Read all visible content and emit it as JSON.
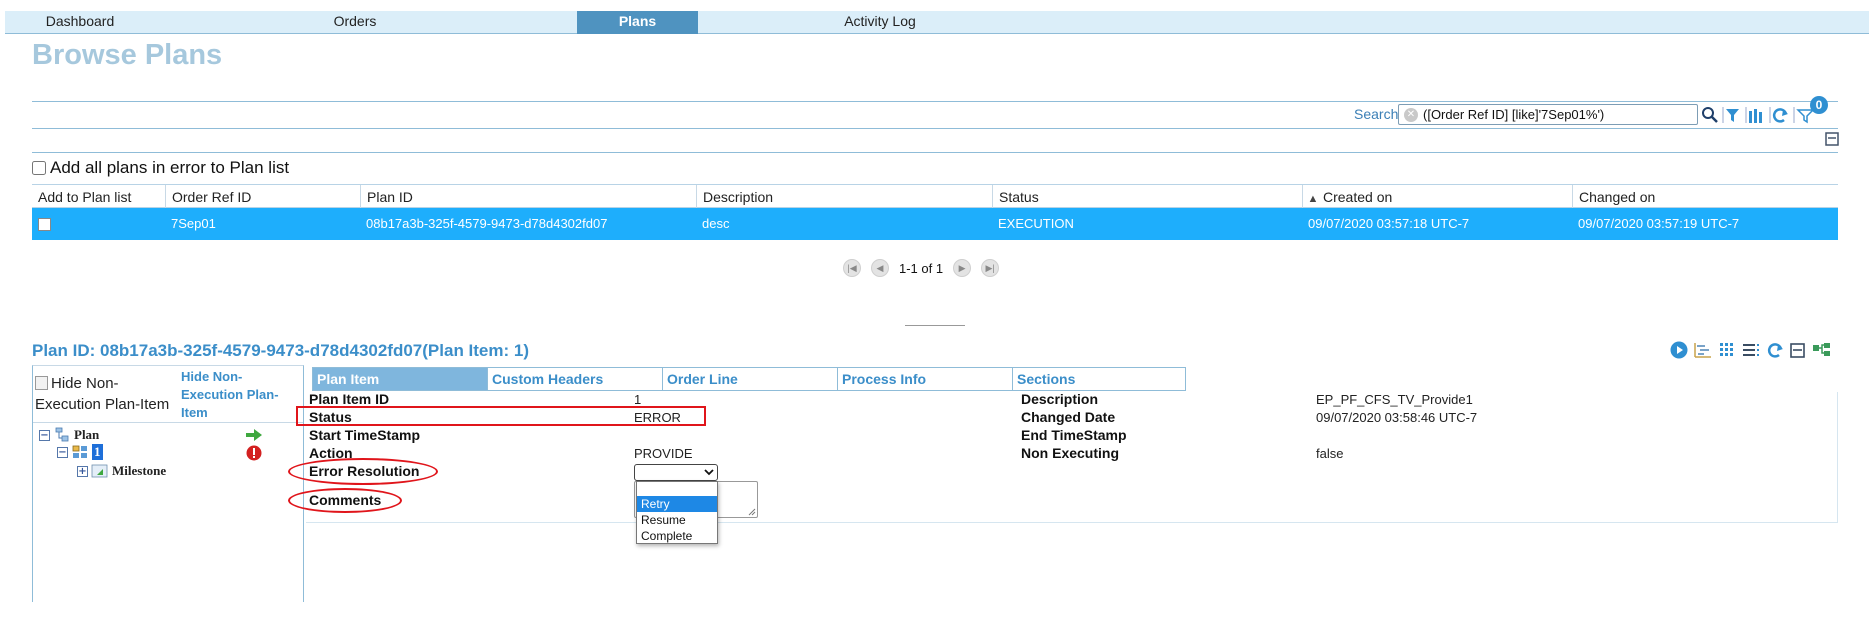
{
  "nav": {
    "tabs": [
      {
        "label": "Dashboard"
      },
      {
        "label": "Orders"
      },
      {
        "label": "Plans"
      },
      {
        "label": "Activity Log"
      }
    ]
  },
  "page": {
    "title": "Browse Plans"
  },
  "search": {
    "label": "Search",
    "value": "([Order Ref ID] [like]'7Sep01%')",
    "filter_count": "0"
  },
  "options": {
    "add_all_label": "Add all plans in error to Plan list"
  },
  "grid": {
    "columns": [
      "Add to Plan list",
      "Order Ref ID",
      "Plan ID",
      "Description",
      "Status",
      "Created on",
      "Changed on"
    ],
    "rows": [
      {
        "order_ref_id": "7Sep01",
        "plan_id": "08b17a3b-325f-4579-9473-d78d4302fd07",
        "description": "desc",
        "status": "EXECUTION",
        "created_on": "09/07/2020 03:57:18 UTC-7",
        "changed_on": "09/07/2020 03:57:19 UTC-7"
      }
    ],
    "pager": "1-1 of 1"
  },
  "detail": {
    "title": "Plan ID: 08b17a3b-325f-4579-9473-d78d4302fd07(Plan Item: 1)",
    "tree": {
      "image_alt": "Hide Non-Execution Plan-Item",
      "hide_link": "Hide Non-Execution Plan-Item",
      "nodes": [
        {
          "label": "Plan"
        },
        {
          "label": "1"
        },
        {
          "label": "Milestone"
        }
      ]
    },
    "tabs": [
      {
        "label": "Plan Item"
      },
      {
        "label": "Custom Headers"
      },
      {
        "label": "Order Line"
      },
      {
        "label": "Process Info"
      },
      {
        "label": "Sections"
      }
    ],
    "fields": {
      "plan_item_id": {
        "label": "Plan Item ID",
        "value": "1"
      },
      "status": {
        "label": "Status",
        "value": "ERROR"
      },
      "start_timestamp": {
        "label": "Start TimeStamp",
        "value": ""
      },
      "action": {
        "label": "Action",
        "value": "PROVIDE"
      },
      "error_resolution": {
        "label": "Error Resolution"
      },
      "comments": {
        "label": "Comments"
      },
      "description": {
        "label": "Description",
        "value": "EP_PF_CFS_TV_Provide1"
      },
      "changed_date": {
        "label": "Changed Date",
        "value": "09/07/2020 03:58:46 UTC-7"
      },
      "end_timestamp": {
        "label": "End TimeStamp",
        "value": ""
      },
      "non_executing": {
        "label": "Non Executing",
        "value": "false"
      }
    },
    "error_resolution_options": [
      "Retry",
      "Resume",
      "Complete"
    ]
  },
  "colors": {
    "accent": "#3b8ec9",
    "row_selected": "#1eaefc",
    "nav_active": "#4f93c0",
    "highlight": "#e0151b"
  }
}
